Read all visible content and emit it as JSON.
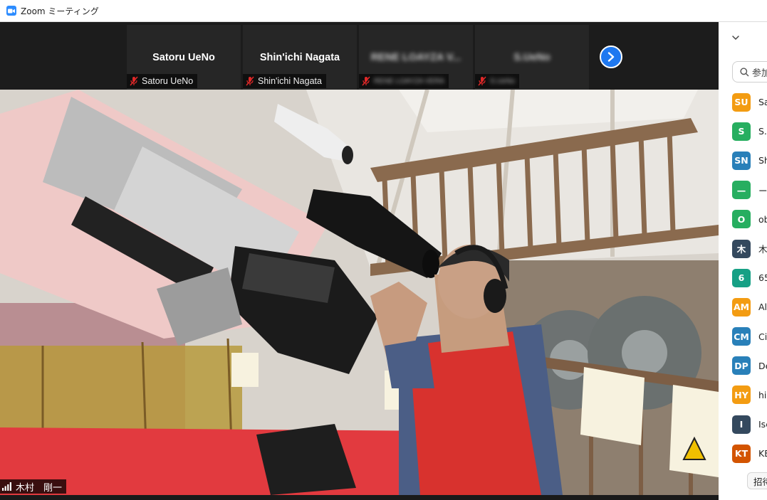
{
  "window": {
    "title": "Zoom ミーティング"
  },
  "thumbnails": [
    {
      "display_name": "Satoru UeNo",
      "tag_name": "Satoru UeNo",
      "blurred": false
    },
    {
      "display_name": "Shin'ichi Nagata",
      "tag_name": "Shin'ichi Nagata",
      "blurred": false
    },
    {
      "display_name": "RENE LOAYZA V...",
      "tag_name": "RENE LOAYZA VERA",
      "blurred": true
    },
    {
      "display_name": "S.UeNo",
      "tag_name": "S.UeNo",
      "blurred": true
    }
  ],
  "main_video": {
    "speaker_name": "木村　剛一"
  },
  "panel": {
    "search_placeholder": "参加",
    "participants": [
      {
        "initials": "SU",
        "name": "Sa",
        "color": "#f39c12"
      },
      {
        "initials": "S",
        "name": "S.",
        "color": "#27ae60"
      },
      {
        "initials": "SN",
        "name": "Sh",
        "color": "#2980b9"
      },
      {
        "initials": "—",
        "name": "ー",
        "color": "#27ae60"
      },
      {
        "initials": "O",
        "name": "ob",
        "color": "#27ae60"
      },
      {
        "initials": "木",
        "name": "木",
        "color": "#34495e"
      },
      {
        "initials": "6",
        "name": "65",
        "color": "#16a085"
      },
      {
        "initials": "AM",
        "name": "Al",
        "color": "#f39c12"
      },
      {
        "initials": "CM",
        "name": "Ci",
        "color": "#2980b9"
      },
      {
        "initials": "DP",
        "name": "De",
        "color": "#2980b9"
      },
      {
        "initials": "HY",
        "name": "hi",
        "color": "#f39c12"
      },
      {
        "initials": "I",
        "name": "Isc",
        "color": "#34495e"
      },
      {
        "initials": "KT",
        "name": "KE",
        "color": "#d35400"
      }
    ],
    "invite_label": "招待"
  }
}
